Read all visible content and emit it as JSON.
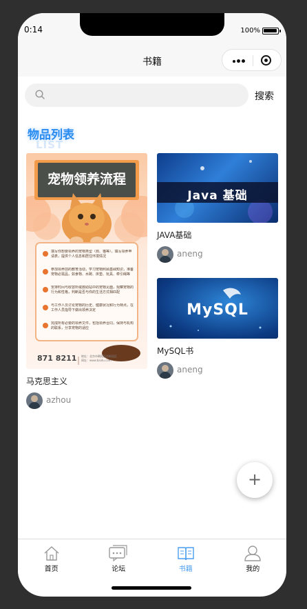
{
  "status": {
    "time": "0:14",
    "battery_pct": "100%",
    "battery_level": 1.0
  },
  "navbar": {
    "title": "书籍"
  },
  "search": {
    "value": "",
    "placeholder": "",
    "button": "搜索"
  },
  "section": {
    "title": "物品列表",
    "ghost": "LIST"
  },
  "items": [
    {
      "name": "马克思主义",
      "author": "azhou",
      "poster": {
        "title": "宠物领养流程",
        "phone": "871 8211",
        "steps": [
          "填写你想要领养的宠物类型（狗、猫等），填写领养申请表，提供个人信息和居住环境情况",
          "参加领养前的教育活动，学习宠物照顾基础知识，准备宠物必需品，如食物、水碗、床垫、玩具、牵引绳等",
          "安排时间与收容所或救助站中的宠物见面，观察宠物的行为和性格，判断是否与你的生活方式相匹配",
          "与工作人员讨论宠物的历史、健康状况和行为特点，在工作人员指导下做出领养决定",
          "完成所有必要的领养文件，包括领养合同，保持与机构的联系，分享宠物的适应"
        ],
        "footer_line1": "地址：北京市朝阳区创新园区",
        "footer_line2": "网址：www.baidu.com"
      }
    },
    {
      "name": "JAVA基础",
      "author": "aneng",
      "banner_text": "Java 基础"
    },
    {
      "name": "MySQL书",
      "author": "aneng",
      "banner_text": "MySQL"
    }
  ],
  "fab": {
    "label": "+"
  },
  "tabs": [
    {
      "label": "首页",
      "icon": "home-icon",
      "active": false
    },
    {
      "label": "论坛",
      "icon": "forum-icon",
      "active": false
    },
    {
      "label": "书籍",
      "icon": "book-icon",
      "active": true
    },
    {
      "label": "我的",
      "icon": "user-icon",
      "active": false
    }
  ],
  "colors": {
    "accent": "#2a8cf0",
    "tab_active": "#4a9ef0"
  }
}
